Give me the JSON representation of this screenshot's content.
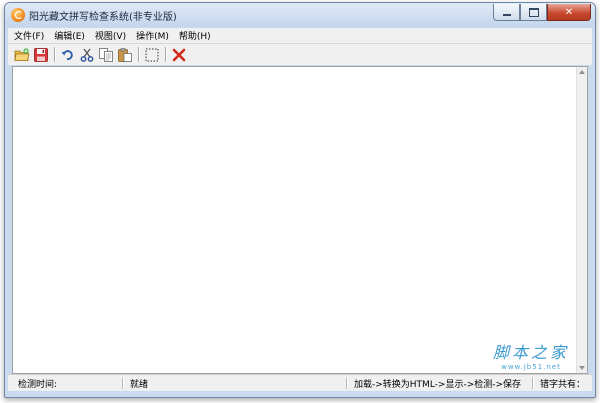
{
  "window": {
    "title": "阳光藏文拼写检查系统(非专业版)"
  },
  "menu": {
    "items": [
      {
        "label": "文件(F)"
      },
      {
        "label": "编辑(E)"
      },
      {
        "label": "视图(V)"
      },
      {
        "label": "操作(M)"
      },
      {
        "label": "帮助(H)"
      }
    ]
  },
  "toolbar": {
    "buttons": [
      "open-icon",
      "save-icon",
      "undo-icon",
      "cut-icon",
      "copy-icon",
      "paste-icon",
      "select-all-icon",
      "delete-icon"
    ]
  },
  "watermark": {
    "text": "脚本之家",
    "url": "www.jb51.net"
  },
  "statusbar": {
    "time_label": "检测时间:",
    "state": "就绪",
    "workflow": "加载->转换为HTML->显示->检测->保存",
    "error_count_label": "错字共有："
  },
  "colors": {
    "accent_close": "#c7452b",
    "delete_red": "#d42a1a",
    "watermark_blue": "#3a9ad0"
  }
}
